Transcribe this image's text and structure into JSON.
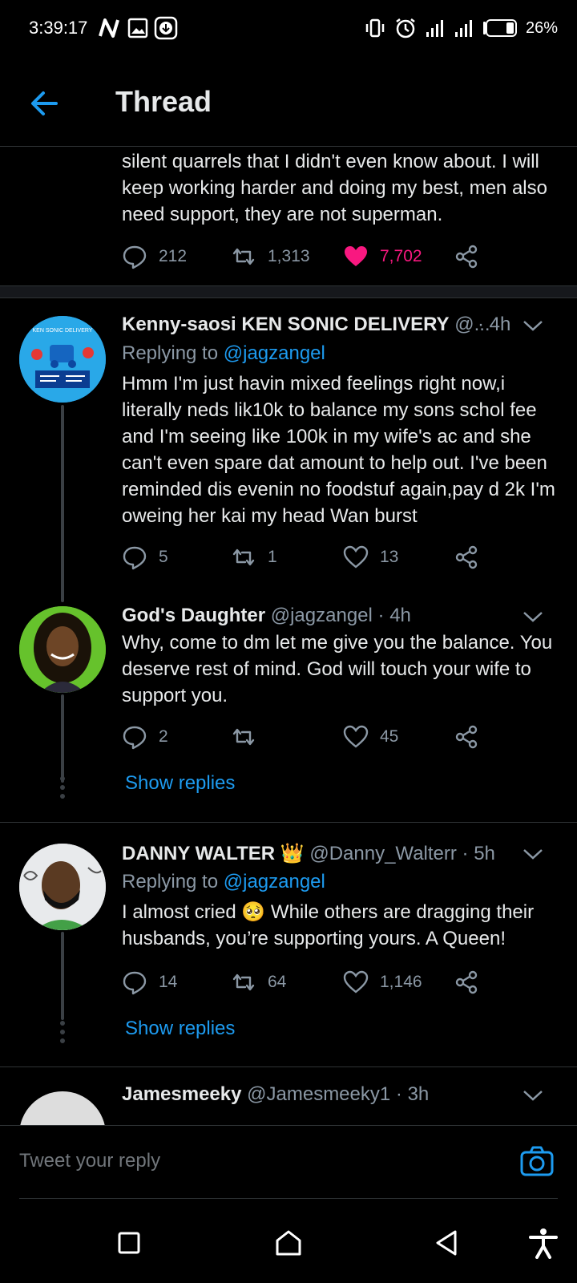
{
  "status_bar": {
    "time": "3:39:17",
    "battery": "26%",
    "icons": [
      "n-notification-icon",
      "image-notification-icon",
      "download-notification-icon",
      "vibrate-icon",
      "alarm-icon",
      "signal-icon",
      "signal-icon",
      "battery-icon"
    ]
  },
  "header": {
    "title": "Thread",
    "back_icon": "arrow-left-icon"
  },
  "main_tweet": {
    "text": "silent quarrels that I didn't even know about. I will keep working harder and doing my best, men also need support, they are not superman.",
    "replies": "212",
    "retweets": "1,313",
    "likes": "7,702",
    "liked": true
  },
  "replies": [
    {
      "name": "Kenny-saosi KEN SONIC DELIVERY",
      "handle": "@...",
      "time": "· 4h",
      "replying_to_prefix": "Replying to",
      "replying_to": "@jagzangel",
      "text": "Hmm I'm just havin mixed feelings right now,i literally neds lik10k to balance my sons schol fee and I'm seeing like 100k in my wife's ac and she can't even spare dat amount to help out. I've been reminded dis evenin no foodstuf again,pay d 2k I'm oweing her kai my head Wan burst",
      "replies": "5",
      "retweets": "1",
      "likes": "13",
      "avatar_text": "KEN SONIC DELIVERY"
    },
    {
      "name": "God's Daughter",
      "handle": "@jagzangel",
      "time": "· 4h",
      "text": "Why, come to dm let me give you the balance. You deserve rest of mind. God will touch your wife to support you.",
      "replies": "2",
      "retweets": "",
      "likes": "45",
      "show_replies": "Show replies"
    },
    {
      "name": "DANNY WALTER",
      "badge": "👑",
      "handle": "@Danny_Walterr",
      "time": "· 5h",
      "replying_to_prefix": "Replying to",
      "replying_to": "@jagzangel",
      "text": "I almost cried 🥺 While others are dragging their husbands, you’re supporting yours. A Queen!",
      "replies": "14",
      "retweets": "64",
      "likes": "1,146",
      "show_replies": "Show replies"
    },
    {
      "name": "Jamesmeeky",
      "handle": "@Jamesmeeky1",
      "time": "· 3h"
    }
  ],
  "composer": {
    "placeholder": "Tweet your reply"
  },
  "colors": {
    "background": "#000000",
    "accent": "#1d9bf0",
    "like": "#f91880",
    "muted": "#8b98a5"
  }
}
